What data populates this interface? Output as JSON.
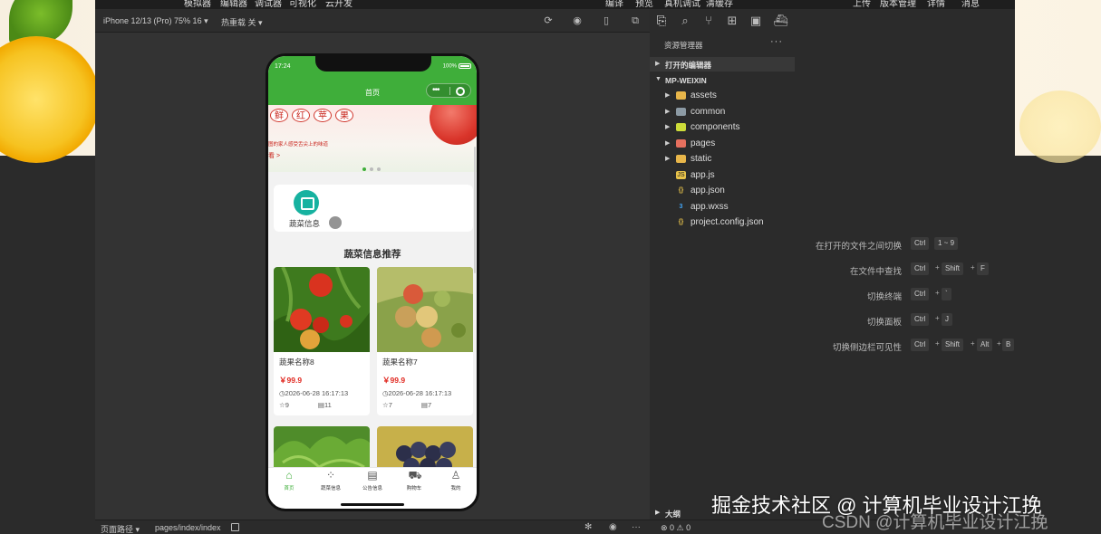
{
  "menubar": [
    "模拟器",
    "编辑器",
    "调试器",
    "可视化",
    "云开发",
    "编译",
    "预览",
    "真机调试",
    "清缓存",
    "上传",
    "版本管理",
    "详情",
    "消息"
  ],
  "sim_toolbar": {
    "device": "iPhone 12/13 (Pro) 75% 16 ▾",
    "hot_reload": "热重载 关 ▾"
  },
  "phone": {
    "status_time": "17:24",
    "battery": "100%",
    "nav_title": "首页",
    "banner": {
      "chars": [
        "鲜",
        "红",
        "苹",
        "果"
      ],
      "subtitle": "图的家人感受舌尖上的味道",
      "link": "看 >"
    },
    "category": {
      "label": "蔬菜信息"
    },
    "section_title": "蔬菜信息推荐",
    "products": [
      {
        "name": "蔬果名称8",
        "price": "￥99.9",
        "time": "2026-06-28 16:17:13",
        "likes": "9",
        "comments": "11"
      },
      {
        "name": "蔬果名称7",
        "price": "￥99.9",
        "time": "2026-06-28 16:17:13",
        "likes": "7",
        "comments": "7"
      }
    ],
    "tabs": [
      {
        "label": "首页",
        "icon": "home-icon"
      },
      {
        "label": "蔬菜信息",
        "icon": "grid-icon"
      },
      {
        "label": "公告信息",
        "icon": "news-icon"
      },
      {
        "label": "购物车",
        "icon": "cart-icon"
      },
      {
        "label": "我的",
        "icon": "user-icon"
      }
    ]
  },
  "explorer": {
    "title": "资源管理器",
    "open_editors": "打开的编辑器",
    "project": "MP-WEIXIN",
    "items": [
      {
        "name": "assets",
        "type": "folder"
      },
      {
        "name": "common",
        "type": "folder"
      },
      {
        "name": "components",
        "type": "folder"
      },
      {
        "name": "pages",
        "type": "folder"
      },
      {
        "name": "static",
        "type": "folder"
      },
      {
        "name": "app.js",
        "type": "js"
      },
      {
        "name": "app.json",
        "type": "json"
      },
      {
        "name": "app.wxss",
        "type": "wxss"
      },
      {
        "name": "project.config.json",
        "type": "json"
      }
    ],
    "outline": "大纲"
  },
  "shortcuts": [
    {
      "label": "在打开的文件之间切换",
      "keys": [
        "Ctrl",
        "1 ~ 9"
      ]
    },
    {
      "label": "在文件中查找",
      "keys": [
        "Ctrl",
        "Shift",
        "F"
      ]
    },
    {
      "label": "切换终端",
      "keys": [
        "Ctrl",
        "`"
      ]
    },
    {
      "label": "切换面板",
      "keys": [
        "Ctrl",
        "J"
      ]
    },
    {
      "label": "切换侧边栏可见性",
      "keys": [
        "Ctrl",
        "Shift",
        "Alt",
        "B"
      ]
    }
  ],
  "statusbar": {
    "path_label": "页面路径 ▾",
    "path": "pages/index/index",
    "errors": "⊗ 0 ⚠ 0"
  },
  "watermark": {
    "line1": "掘金技术社区 @ 计算机毕业设计江挽",
    "line2": "CSDN @计算机毕业设计江挽"
  }
}
